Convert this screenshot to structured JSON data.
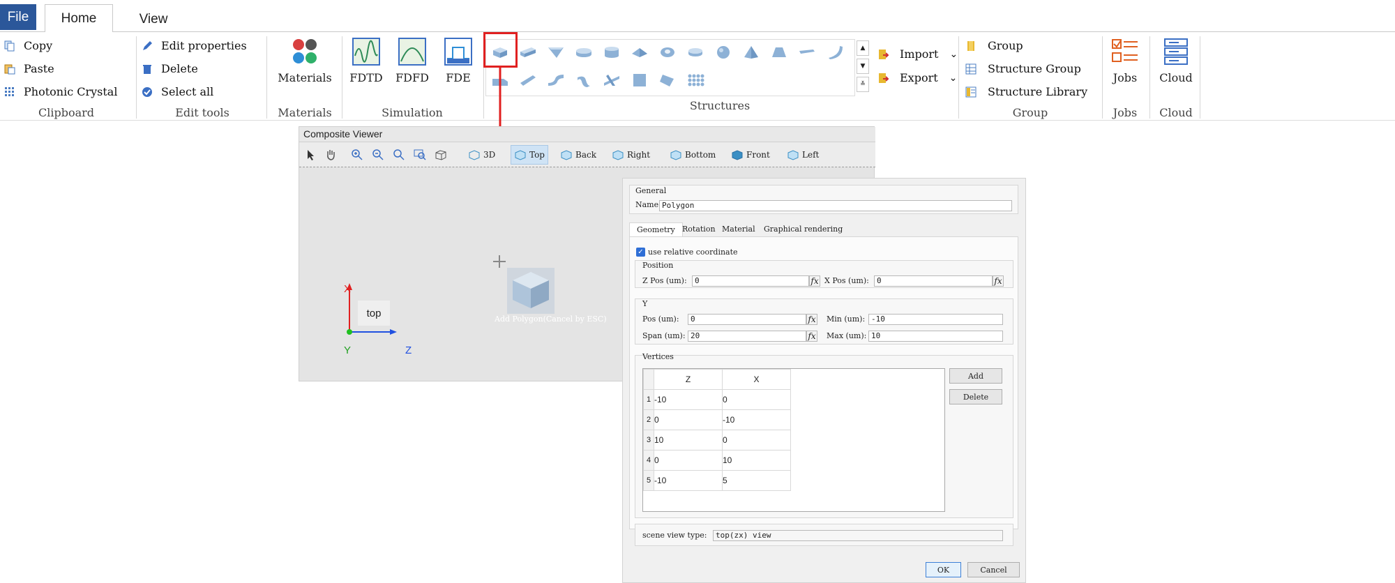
{
  "tabs": {
    "file": "File",
    "home": "Home",
    "view": "View"
  },
  "clipboard": {
    "copy": "Copy",
    "paste": "Paste",
    "photonic": "Photonic Crystal",
    "label": "Clipboard"
  },
  "edit": {
    "edit_props": "Edit properties",
    "delete": "Delete",
    "select_all": "Select all",
    "label": "Edit tools"
  },
  "materials": {
    "button": "Materials",
    "label": "Materials"
  },
  "simulation": {
    "fdtd": "FDTD",
    "fdfd": "FDFD",
    "fde": "FDE",
    "label": "Simulation"
  },
  "structures": {
    "label": "Structures",
    "import": "Import",
    "export": "Export"
  },
  "group": {
    "group": "Group",
    "structure_group": "Structure Group",
    "structure_library": "Structure Library",
    "label": "Group"
  },
  "jobs": {
    "button": "Jobs",
    "label": "Jobs"
  },
  "cloud": {
    "button": "Cloud",
    "label": "Cloud"
  },
  "viewer": {
    "title": "Composite Viewer",
    "view_3d": "3D",
    "top": "Top",
    "back": "Back",
    "right": "Right",
    "bottom": "Bottom",
    "front": "Front",
    "left": "Left",
    "top_label": "top",
    "axis_x": "X",
    "axis_y": "Y",
    "axis_z": "Z",
    "hint": "Add Polygon(Cancel by ESC)"
  },
  "dialog": {
    "general": "General",
    "name_label": "Name:",
    "name_value": "Polygon",
    "tabs": [
      "Geometry",
      "Rotation",
      "Material",
      "Graphical rendering"
    ],
    "use_relative": "use relative coordinate",
    "position": "Position",
    "zpos_label": "Z Pos (um):",
    "zpos": "0",
    "xpos_label": "X Pos (um):",
    "xpos": "0",
    "y_section": "Y",
    "pos_label": "Pos (um):",
    "pos": "0",
    "min_label": "Min (um):",
    "min": "-10",
    "span_label": "Span (um):",
    "span": "20",
    "max_label": "Max (um):",
    "max": "10",
    "vertices": "Vertices",
    "col_z": "Z",
    "col_x": "X",
    "rows": [
      {
        "n": "1",
        "z": "-10",
        "x": "0"
      },
      {
        "n": "2",
        "z": "0",
        "x": "-10"
      },
      {
        "n": "3",
        "z": "10",
        "x": "0"
      },
      {
        "n": "4",
        "z": "0",
        "x": "10"
      },
      {
        "n": "5",
        "z": "-10",
        "x": "5"
      }
    ],
    "add": "Add",
    "delete": "Delete",
    "scene_label": "scene view type:",
    "scene_value": "top(zx) view",
    "ok": "OK",
    "cancel": "Cancel"
  },
  "colors": {
    "accent": "#2b579a",
    "highlight": "#e02020"
  }
}
